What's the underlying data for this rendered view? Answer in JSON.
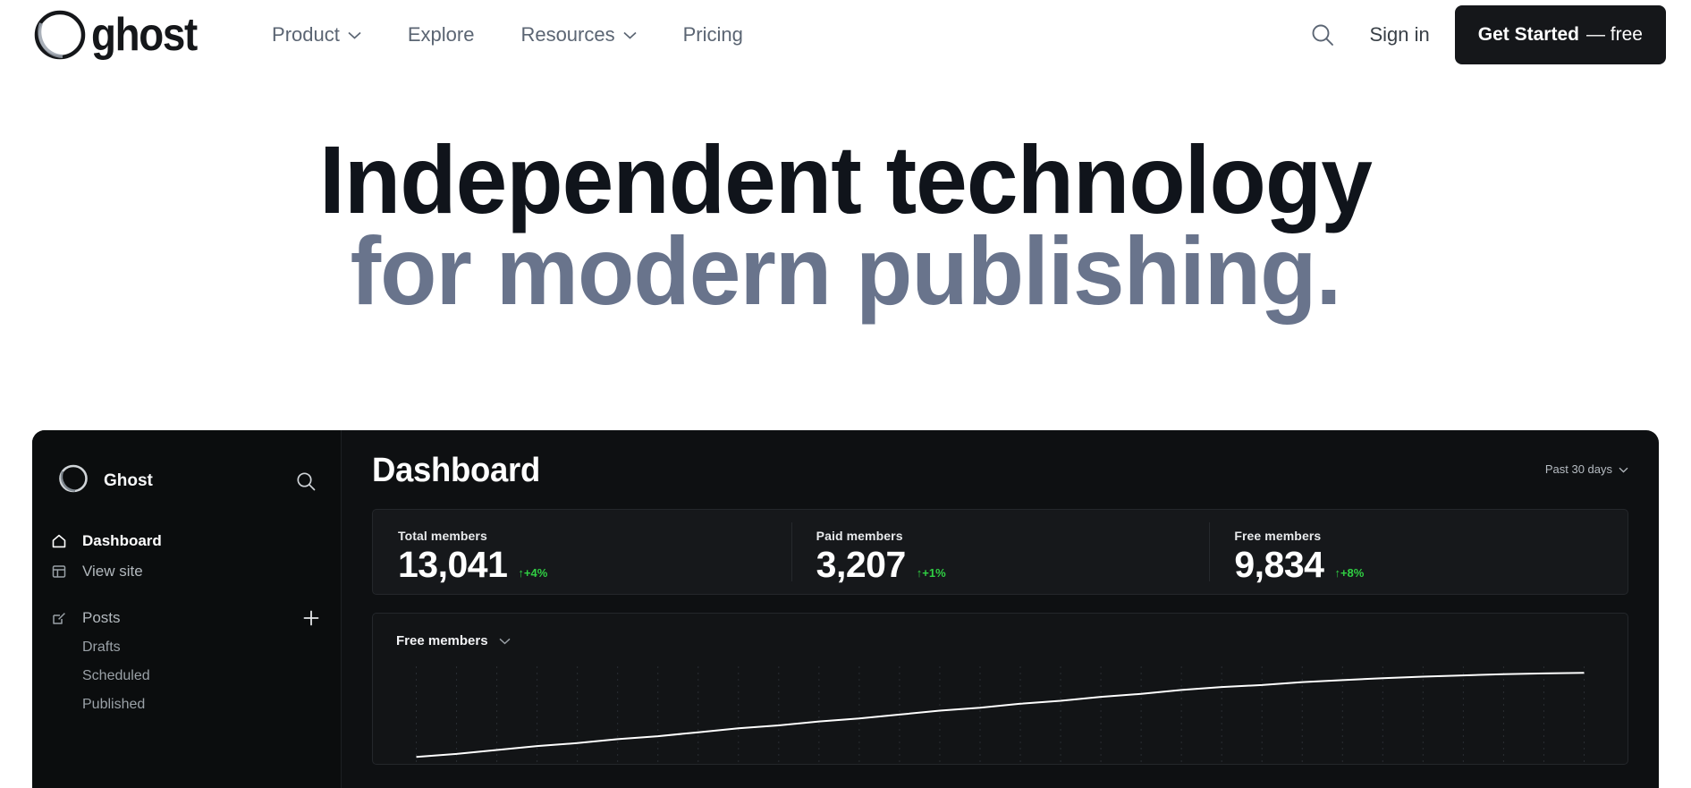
{
  "site_nav": {
    "brand": {
      "word": "ghost",
      "icon": "ghost-logo-icon"
    },
    "links": [
      {
        "label": "Product",
        "has_dropdown": true
      },
      {
        "label": "Explore",
        "has_dropdown": false
      },
      {
        "label": "Resources",
        "has_dropdown": true
      },
      {
        "label": "Pricing",
        "has_dropdown": false
      }
    ],
    "search_icon": "search-icon",
    "signin_label": "Sign in",
    "cta_label_bold": "Get Started",
    "cta_label_rest": "— free"
  },
  "hero": {
    "line1": "Independent technology",
    "line2_muted": "for modern publishing",
    "line2_dot": "."
  },
  "app": {
    "sidebar": {
      "site_name": "Ghost",
      "avatar_icon": "ghost-avatar-icon",
      "search_icon": "search-icon",
      "items": [
        {
          "label": "Dashboard",
          "icon": "home-icon",
          "active": true
        },
        {
          "label": "View site",
          "icon": "layout-icon",
          "active": false
        },
        {
          "label": "Posts",
          "icon": "edit-icon",
          "active": false,
          "has_add": true,
          "add_icon": "plus-icon"
        }
      ],
      "sub_items": [
        {
          "label": "Drafts"
        },
        {
          "label": "Scheduled"
        },
        {
          "label": "Published"
        }
      ]
    },
    "main": {
      "page_title": "Dashboard",
      "date_range": "Past 30 days",
      "date_range_icon": "chevron-down-icon",
      "stats": [
        {
          "label": "Total members",
          "value": "13,041",
          "delta": "+4%",
          "delta_arrow": "↑",
          "delta_color": "#30cf43"
        },
        {
          "label": "Paid members",
          "value": "3,207",
          "delta": "+1%",
          "delta_arrow": "↑",
          "delta_color": "#30cf43"
        },
        {
          "label": "Free members",
          "value": "9,834",
          "delta": "+8%",
          "delta_arrow": "↑",
          "delta_color": "#30cf43"
        }
      ],
      "chart": {
        "select_label": "Free members",
        "select_icon": "chevron-down-icon"
      }
    }
  },
  "chart_data": {
    "type": "line",
    "title": "Free members",
    "xlabel": "",
    "ylabel": "",
    "grid": true,
    "legend": "none",
    "x": [
      1,
      2,
      3,
      4,
      5,
      6,
      7,
      8,
      9,
      10,
      11,
      12,
      13,
      14,
      15,
      16,
      17,
      18,
      19,
      20,
      21,
      22,
      23,
      24,
      25,
      26,
      27,
      28,
      29,
      30
    ],
    "series": [
      {
        "name": "Free members",
        "values": [
          8980,
          9010,
          9050,
          9090,
          9120,
          9160,
          9190,
          9230,
          9270,
          9300,
          9340,
          9370,
          9410,
          9450,
          9480,
          9520,
          9550,
          9590,
          9620,
          9660,
          9690,
          9710,
          9740,
          9760,
          9780,
          9795,
          9808,
          9820,
          9828,
          9834
        ]
      }
    ],
    "ylim": [
      8900,
      9900
    ]
  }
}
